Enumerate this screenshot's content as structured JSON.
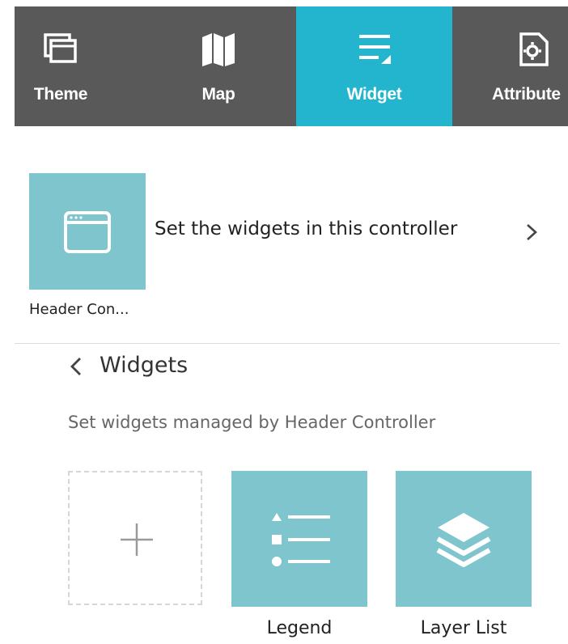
{
  "tabs": [
    {
      "label": "Theme",
      "icon": "theme-icon",
      "active": false
    },
    {
      "label": "Map",
      "icon": "map-icon",
      "active": false
    },
    {
      "label": "Widget",
      "icon": "widget-icon",
      "active": true
    },
    {
      "label": "Attribute",
      "icon": "attribute-icon",
      "active": false
    }
  ],
  "controller": {
    "name": "Header Con...",
    "set_text": "Set the widgets in this controller",
    "icon": "window-icon"
  },
  "widgets_panel": {
    "title": "Widgets",
    "description": "Set widgets managed by Header Controller",
    "add_icon": "plus-icon",
    "items": [
      {
        "label": "Legend",
        "icon": "legend-icon"
      },
      {
        "label": "Layer List",
        "icon": "layers-icon"
      }
    ]
  },
  "colors": {
    "tab_bar": "#595959",
    "tab_active": "#24b5ce",
    "tile": "#7fc5ce"
  }
}
